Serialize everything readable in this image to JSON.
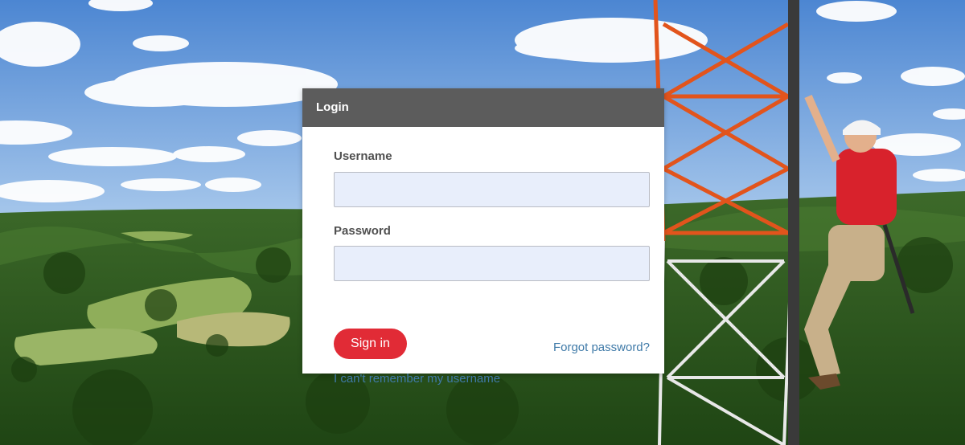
{
  "login": {
    "title": "Login",
    "username_label": "Username",
    "username_value": "",
    "password_label": "Password",
    "password_value": "",
    "sign_in_label": "Sign in",
    "forgot_password_label": "Forgot password?",
    "forgot_username_label": "I can't remember my username"
  },
  "colors": {
    "header_bg": "#5c5c5c",
    "primary_button": "#e12b36",
    "link": "#3f7aa8",
    "input_bg": "#e8eefb"
  },
  "background": {
    "icon": "landscape-photo",
    "tower_icon": "radio-tower",
    "worker_icon": "climbing-worker"
  }
}
